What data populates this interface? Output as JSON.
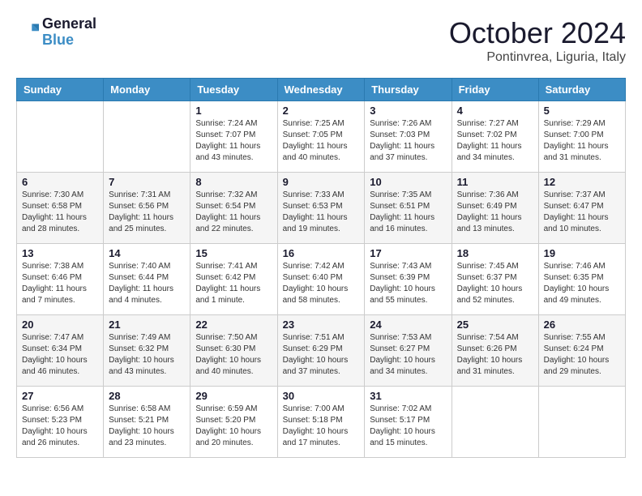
{
  "header": {
    "logo_line1": "General",
    "logo_line2": "Blue",
    "month": "October 2024",
    "location": "Pontinvrea, Liguria, Italy"
  },
  "weekdays": [
    "Sunday",
    "Monday",
    "Tuesday",
    "Wednesday",
    "Thursday",
    "Friday",
    "Saturday"
  ],
  "weeks": [
    [
      {
        "day": "",
        "info": ""
      },
      {
        "day": "",
        "info": ""
      },
      {
        "day": "1",
        "info": "Sunrise: 7:24 AM\nSunset: 7:07 PM\nDaylight: 11 hours\nand 43 minutes."
      },
      {
        "day": "2",
        "info": "Sunrise: 7:25 AM\nSunset: 7:05 PM\nDaylight: 11 hours\nand 40 minutes."
      },
      {
        "day": "3",
        "info": "Sunrise: 7:26 AM\nSunset: 7:03 PM\nDaylight: 11 hours\nand 37 minutes."
      },
      {
        "day": "4",
        "info": "Sunrise: 7:27 AM\nSunset: 7:02 PM\nDaylight: 11 hours\nand 34 minutes."
      },
      {
        "day": "5",
        "info": "Sunrise: 7:29 AM\nSunset: 7:00 PM\nDaylight: 11 hours\nand 31 minutes."
      }
    ],
    [
      {
        "day": "6",
        "info": "Sunrise: 7:30 AM\nSunset: 6:58 PM\nDaylight: 11 hours\nand 28 minutes."
      },
      {
        "day": "7",
        "info": "Sunrise: 7:31 AM\nSunset: 6:56 PM\nDaylight: 11 hours\nand 25 minutes."
      },
      {
        "day": "8",
        "info": "Sunrise: 7:32 AM\nSunset: 6:54 PM\nDaylight: 11 hours\nand 22 minutes."
      },
      {
        "day": "9",
        "info": "Sunrise: 7:33 AM\nSunset: 6:53 PM\nDaylight: 11 hours\nand 19 minutes."
      },
      {
        "day": "10",
        "info": "Sunrise: 7:35 AM\nSunset: 6:51 PM\nDaylight: 11 hours\nand 16 minutes."
      },
      {
        "day": "11",
        "info": "Sunrise: 7:36 AM\nSunset: 6:49 PM\nDaylight: 11 hours\nand 13 minutes."
      },
      {
        "day": "12",
        "info": "Sunrise: 7:37 AM\nSunset: 6:47 PM\nDaylight: 11 hours\nand 10 minutes."
      }
    ],
    [
      {
        "day": "13",
        "info": "Sunrise: 7:38 AM\nSunset: 6:46 PM\nDaylight: 11 hours\nand 7 minutes."
      },
      {
        "day": "14",
        "info": "Sunrise: 7:40 AM\nSunset: 6:44 PM\nDaylight: 11 hours\nand 4 minutes."
      },
      {
        "day": "15",
        "info": "Sunrise: 7:41 AM\nSunset: 6:42 PM\nDaylight: 11 hours\nand 1 minute."
      },
      {
        "day": "16",
        "info": "Sunrise: 7:42 AM\nSunset: 6:40 PM\nDaylight: 10 hours\nand 58 minutes."
      },
      {
        "day": "17",
        "info": "Sunrise: 7:43 AM\nSunset: 6:39 PM\nDaylight: 10 hours\nand 55 minutes."
      },
      {
        "day": "18",
        "info": "Sunrise: 7:45 AM\nSunset: 6:37 PM\nDaylight: 10 hours\nand 52 minutes."
      },
      {
        "day": "19",
        "info": "Sunrise: 7:46 AM\nSunset: 6:35 PM\nDaylight: 10 hours\nand 49 minutes."
      }
    ],
    [
      {
        "day": "20",
        "info": "Sunrise: 7:47 AM\nSunset: 6:34 PM\nDaylight: 10 hours\nand 46 minutes."
      },
      {
        "day": "21",
        "info": "Sunrise: 7:49 AM\nSunset: 6:32 PM\nDaylight: 10 hours\nand 43 minutes."
      },
      {
        "day": "22",
        "info": "Sunrise: 7:50 AM\nSunset: 6:30 PM\nDaylight: 10 hours\nand 40 minutes."
      },
      {
        "day": "23",
        "info": "Sunrise: 7:51 AM\nSunset: 6:29 PM\nDaylight: 10 hours\nand 37 minutes."
      },
      {
        "day": "24",
        "info": "Sunrise: 7:53 AM\nSunset: 6:27 PM\nDaylight: 10 hours\nand 34 minutes."
      },
      {
        "day": "25",
        "info": "Sunrise: 7:54 AM\nSunset: 6:26 PM\nDaylight: 10 hours\nand 31 minutes."
      },
      {
        "day": "26",
        "info": "Sunrise: 7:55 AM\nSunset: 6:24 PM\nDaylight: 10 hours\nand 29 minutes."
      }
    ],
    [
      {
        "day": "27",
        "info": "Sunrise: 6:56 AM\nSunset: 5:23 PM\nDaylight: 10 hours\nand 26 minutes."
      },
      {
        "day": "28",
        "info": "Sunrise: 6:58 AM\nSunset: 5:21 PM\nDaylight: 10 hours\nand 23 minutes."
      },
      {
        "day": "29",
        "info": "Sunrise: 6:59 AM\nSunset: 5:20 PM\nDaylight: 10 hours\nand 20 minutes."
      },
      {
        "day": "30",
        "info": "Sunrise: 7:00 AM\nSunset: 5:18 PM\nDaylight: 10 hours\nand 17 minutes."
      },
      {
        "day": "31",
        "info": "Sunrise: 7:02 AM\nSunset: 5:17 PM\nDaylight: 10 hours\nand 15 minutes."
      },
      {
        "day": "",
        "info": ""
      },
      {
        "day": "",
        "info": ""
      }
    ]
  ]
}
